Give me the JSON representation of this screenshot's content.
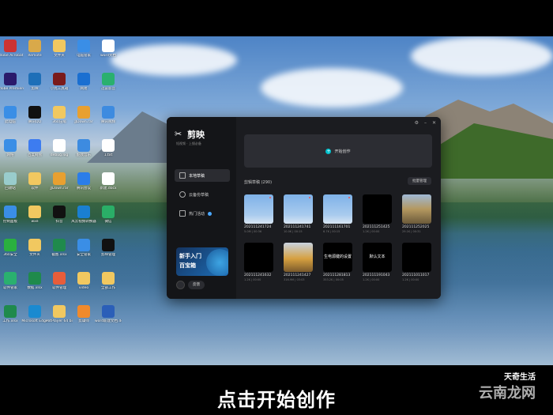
{
  "desktop_icons": [
    {
      "label": "Adobe Acrobat",
      "color": "#c33"
    },
    {
      "label": "Remote",
      "color": "#d9a94a"
    },
    {
      "label": "文件夹",
      "color": "#f1c860"
    },
    {
      "label": "电脑管家",
      "color": "#3a8ee6"
    },
    {
      "label": "word文档",
      "color": "#fff"
    },
    {
      "label": "Adobe Premiere",
      "color": "#2a1a6b"
    },
    {
      "label": "剪映",
      "color": "#1e6fb8"
    },
    {
      "label": "小丸工具箱",
      "color": "#7a1b1b"
    },
    {
      "label": "网易",
      "color": "#1a6fd1"
    },
    {
      "label": "迅雷影音",
      "color": "#2ab06f"
    },
    {
      "label": "此电脑",
      "color": "#3a8ee6"
    },
    {
      "label": "腾讯QQ",
      "color": "#111"
    },
    {
      "label": "360压缩",
      "color": "#f1c860"
    },
    {
      "label": "JJDown.rar",
      "color": "#e8a030"
    },
    {
      "label": "腾讯视频",
      "color": "#3d8be0"
    },
    {
      "label": "网络",
      "color": "#3a8ee6"
    },
    {
      "label": "百度网盘",
      "color": "#3d7cf0"
    },
    {
      "label": "debug.log",
      "color": "#fff"
    },
    {
      "label": "酷我音乐",
      "color": "#3d8be0"
    },
    {
      "label": "1.txt",
      "color": "#fff"
    },
    {
      "label": "回收站",
      "color": "#9cc"
    },
    {
      "label": "软件",
      "color": "#f1c860"
    },
    {
      "label": "JJDown.rar",
      "color": "#e8a030"
    },
    {
      "label": "腾讯会议",
      "color": "#2b7de9"
    },
    {
      "label": "新建.docx",
      "color": "#fff"
    },
    {
      "label": "控制面板",
      "color": "#3a8ee6"
    },
    {
      "label": "wxe",
      "color": "#f1c860"
    },
    {
      "label": "抖音",
      "color": "#111"
    },
    {
      "label": "风云视频转换器",
      "color": "#1a7fd1"
    },
    {
      "label": "微信",
      "color": "#2aae67"
    },
    {
      "label": "360安全",
      "color": "#2ab03f"
    },
    {
      "label": "文件夹",
      "color": "#f1c860"
    },
    {
      "label": "截图.xlsx",
      "color": "#1f8a4c"
    },
    {
      "label": "安全管家",
      "color": "#3a8ee6"
    },
    {
      "label": "剪映管理",
      "color": "#111"
    },
    {
      "label": "软件管家",
      "color": "#2ab06f"
    },
    {
      "label": "数据.xlsx",
      "color": "#1f8a4c"
    },
    {
      "label": "软件管理",
      "color": "#e85d3a"
    },
    {
      "label": "video",
      "color": "#f1c860"
    },
    {
      "label": "全部工作",
      "color": "#f1c860"
    },
    {
      "label": "工作.xlsx",
      "color": "#1f8a4c"
    },
    {
      "label": "Microsoft Edge",
      "color": "#1a8ad0"
    },
    {
      "label": "PotPlayer 64 bit",
      "color": "#f1c860"
    },
    {
      "label": "剪辑师",
      "color": "#f08a2c"
    },
    {
      "label": "word新建文档.docx",
      "color": "#2b5fb8"
    }
  ],
  "app": {
    "logo_text": "剪映",
    "logo_sub": "短视频 · 上镜必备",
    "nav": [
      {
        "label": "本地草稿",
        "active": true
      },
      {
        "label": "云备份草稿",
        "active": false
      },
      {
        "label": "热门活动",
        "active": false
      }
    ],
    "banner": {
      "line1": "新手入门",
      "line2": "百宝箱"
    },
    "feedback_label": "反馈",
    "create_label": "开始创作",
    "drafts_title": "剪辑草稿 (290)",
    "manage_label": "批量管理",
    "drafts": [
      {
        "name": "202111241724",
        "meta": "5.0M | 00:36",
        "style": "sky",
        "text": ""
      },
      {
        "name": "202111241741",
        "meta": "10.0K | 00:15",
        "style": "sky",
        "text": ""
      },
      {
        "name": "202111161701",
        "meta": "6.7K | 00:15",
        "style": "sky",
        "text": ""
      },
      {
        "name": "202111251425",
        "meta": "1.2K | 00:00",
        "style": "black",
        "text": ""
      },
      {
        "name": "202111252025",
        "meta": "29.1K | 00:31",
        "style": "landscape",
        "text": ""
      },
      {
        "name": "202111241632",
        "meta": "1.2K | 00:00",
        "style": "black",
        "text": ""
      },
      {
        "name": "202111241427",
        "meta": "316.9M | 03:03",
        "style": "autumn",
        "text": ""
      },
      {
        "name": "202111281813",
        "meta": "353.2K | 00:05",
        "style": "black",
        "text": "生电源键的设置"
      },
      {
        "name": "202111191043",
        "meta": "1.2K | 00:00",
        "style": "black",
        "text": "默认文本"
      },
      {
        "name": "202111011017",
        "meta": "1.2K | 00:00",
        "style": "black",
        "text": ""
      }
    ]
  },
  "subtitle": "点击开始创作",
  "watermark": {
    "top": "天奇生活",
    "bottom": "云南龙网"
  }
}
